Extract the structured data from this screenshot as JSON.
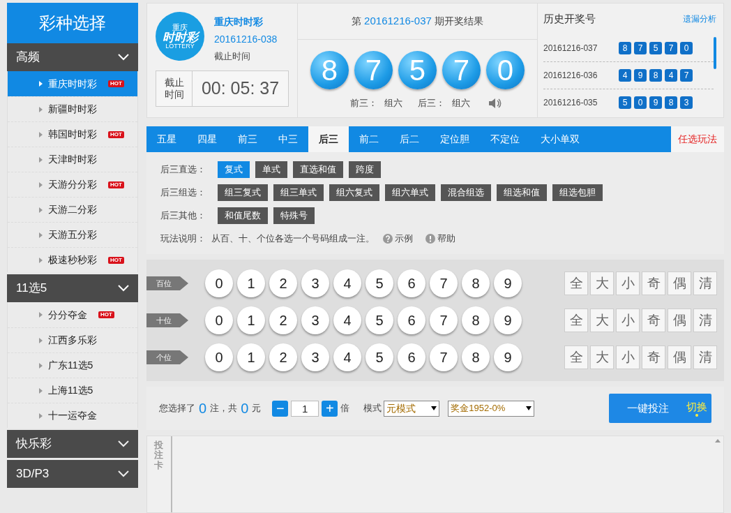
{
  "sidebar": {
    "title": "彩种选择",
    "groups": [
      {
        "label": "高频",
        "expanded": true,
        "items": [
          {
            "label": "重庆时时彩",
            "hot": "HOT",
            "selected": true
          },
          {
            "label": "新疆时时彩",
            "selected": false
          },
          {
            "label": "韩国时时彩",
            "hot": "HOT",
            "selected": false
          },
          {
            "label": "天津时时彩",
            "selected": false
          },
          {
            "label": "天游分分彩",
            "hot": "HOT",
            "selected": false
          },
          {
            "label": "天游二分彩",
            "selected": false
          },
          {
            "label": "天游五分彩",
            "selected": false
          },
          {
            "label": "极速秒秒彩",
            "hot": "HOT",
            "selected": false
          }
        ]
      },
      {
        "label": "11选5",
        "expanded": true,
        "items": [
          {
            "label": "分分夺金",
            "hot": "HOT",
            "selected": false
          },
          {
            "label": "江西多乐彩",
            "selected": false
          },
          {
            "label": "广东11选5",
            "selected": false
          },
          {
            "label": "上海11选5",
            "selected": false
          },
          {
            "label": "十一运夺金",
            "selected": false
          }
        ]
      },
      {
        "label": "快乐彩",
        "expanded": false
      },
      {
        "label": "3D/P3",
        "expanded": false
      }
    ]
  },
  "header": {
    "logo": {
      "top": "重庆",
      "main": "时时彩",
      "sub": "LOTTERY"
    },
    "game": "重庆时时彩",
    "issue": "20161216-038",
    "deadline_label": "截止时间",
    "countdown_label": "截止时间",
    "countdown": "00: 05: 37",
    "result": {
      "prefix": "第",
      "issue": "20161216-037",
      "suffix": "期开奖结果",
      "balls": [
        "8",
        "7",
        "5",
        "7",
        "0"
      ],
      "front_label": "前三：",
      "front_value": "组六",
      "back_label": "后三：",
      "back_value": "组六"
    },
    "history": {
      "title": "历史开奖号",
      "link": "遗漏分析",
      "rows": [
        {
          "issue": "20161216-037",
          "numbers": [
            "8",
            "7",
            "5",
            "7",
            "0"
          ]
        },
        {
          "issue": "20161216-036",
          "numbers": [
            "4",
            "9",
            "8",
            "4",
            "7"
          ]
        },
        {
          "issue": "20161216-035",
          "numbers": [
            "5",
            "0",
            "9",
            "8",
            "3"
          ]
        }
      ]
    }
  },
  "tabs": [
    {
      "label": "五星",
      "selected": false
    },
    {
      "label": "四星",
      "selected": false
    },
    {
      "label": "前三",
      "selected": false
    },
    {
      "label": "中三",
      "selected": false
    },
    {
      "label": "后三",
      "selected": true
    },
    {
      "label": "前二",
      "selected": false
    },
    {
      "label": "后二",
      "selected": false
    },
    {
      "label": "定位胆",
      "selected": false
    },
    {
      "label": "不定位",
      "selected": false
    },
    {
      "label": "大小单双",
      "selected": false
    }
  ],
  "optional_tab": "任选玩法",
  "play_groups": [
    {
      "label": "后三直选：",
      "options": [
        {
          "label": "复式",
          "selected": true
        },
        {
          "label": "单式",
          "selected": false
        },
        {
          "label": "直选和值",
          "selected": false
        },
        {
          "label": "跨度",
          "selected": false
        }
      ]
    },
    {
      "label": "后三组选：",
      "options": [
        {
          "label": "组三复式",
          "selected": false
        },
        {
          "label": "组三单式",
          "selected": false
        },
        {
          "label": "组六复式",
          "selected": false
        },
        {
          "label": "组六单式",
          "selected": false
        },
        {
          "label": "混合组选",
          "selected": false
        },
        {
          "label": "组选和值",
          "selected": false
        },
        {
          "label": "组选包胆",
          "selected": false
        }
      ]
    },
    {
      "label": "后三其他：",
      "options": [
        {
          "label": "和值尾数",
          "selected": false
        },
        {
          "label": "特殊号",
          "selected": false
        }
      ]
    }
  ],
  "description": {
    "label": "玩法说明：",
    "text": "从百、十、个位各选一个号码组成一注。",
    "example": "示例",
    "help": "帮助"
  },
  "positions": [
    {
      "label": "百位",
      "numbers": [
        "0",
        "1",
        "2",
        "3",
        "4",
        "5",
        "6",
        "7",
        "8",
        "9"
      ],
      "filters": [
        "全",
        "大",
        "小",
        "奇",
        "偶",
        "清"
      ]
    },
    {
      "label": "十位",
      "numbers": [
        "0",
        "1",
        "2",
        "3",
        "4",
        "5",
        "6",
        "7",
        "8",
        "9"
      ],
      "filters": [
        "全",
        "大",
        "小",
        "奇",
        "偶",
        "清"
      ]
    },
    {
      "label": "个位",
      "numbers": [
        "0",
        "1",
        "2",
        "3",
        "4",
        "5",
        "6",
        "7",
        "8",
        "9"
      ],
      "filters": [
        "全",
        "大",
        "小",
        "奇",
        "偶",
        "清"
      ]
    }
  ],
  "summary": {
    "prefix": "您选择了",
    "bets": "0",
    "bets_unit": "注，共",
    "amount": "0",
    "amount_unit": "元",
    "minus": "−",
    "multiple": "1",
    "plus": "+",
    "multiple_unit": "倍",
    "mode_label": "模式",
    "mode": "元模式",
    "prize": "奖金1952-0%",
    "submit": "一键投注",
    "switch": "切换"
  },
  "bet_card": {
    "label": "投注卡"
  }
}
